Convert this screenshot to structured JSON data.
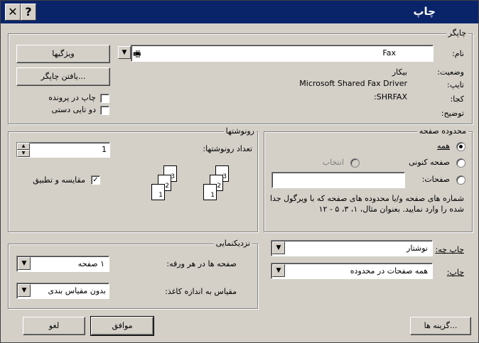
{
  "title": "چاپ",
  "titlebar": {
    "help": "?",
    "close": "✕"
  },
  "printer": {
    "group_label": "چاپگر",
    "name_label": "نام:",
    "name_value": "Fax",
    "status_label": "وضعیت:",
    "status_value": "بیکار",
    "type_label": "تایپ:",
    "type_value": "Microsoft Shared Fax Driver",
    "where_label": "کجا:",
    "where_value": "SHRFAX:",
    "comment_label": "توضیح:",
    "properties_button": "ویژگیها",
    "find_printer_button": "یافتن چاپگر...",
    "print_to_file_label": "چاپ در پرونده",
    "manual_duplex_label": "دو تایی دستی"
  },
  "page_range": {
    "group_label": "محدوده صفحه",
    "all_label": "همه",
    "current_page_label": "صفحه کنونی",
    "selection_label": "انتخاب",
    "pages_label": "صفحات:",
    "pages_value": "",
    "hint": "شماره های صفحه و/یا محدوده های صفحه که با ویرگول جدا شده را وارد نمایید. بعنوان مثال، ۱، ۳، ۵ - ۱۲"
  },
  "copies": {
    "group_label": "رونوشتها",
    "count_label": "تعداد رونوشتها:",
    "count_value": "1",
    "collate_label": "مقایسه و تطبیق",
    "page_numbers": [
      "1",
      "2",
      "3"
    ]
  },
  "print_what": {
    "label": "چاپ چه:",
    "value": "نوشتار"
  },
  "print": {
    "label": "چاپ:",
    "value": "همه صفحات در محدوده"
  },
  "zoom": {
    "group_label": "نزدیکنمایی",
    "pages_per_sheet_label": "صفحه ها در هر ورقه:",
    "pages_per_sheet_value": "۱ صفحه",
    "scale_label": "مقیاس به اندازه کاغذ:",
    "scale_value": "بدون مقیاس بندی"
  },
  "footer": {
    "options_button": "گزینه ها...",
    "ok_button": "موافق",
    "cancel_button": "لغو"
  }
}
